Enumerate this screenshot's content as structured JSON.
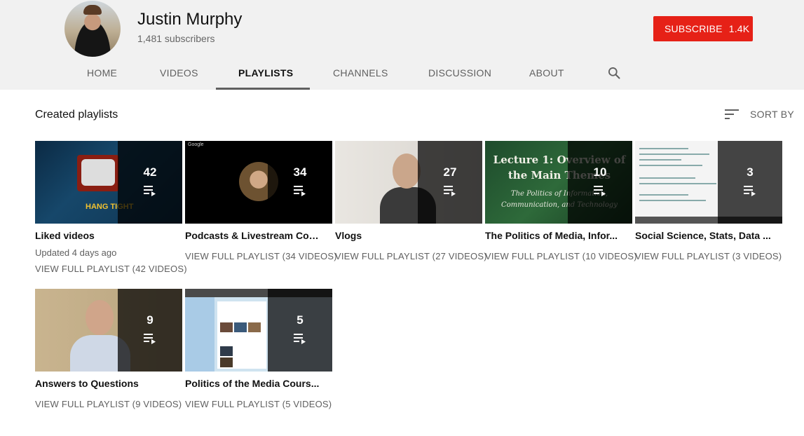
{
  "channel": {
    "name": "Justin Murphy",
    "subscribers": "1,481 subscribers",
    "subscribe_label": "SUBSCRIBE",
    "subscribe_count": "1.4K",
    "accent_color": "#e62117"
  },
  "tabs": [
    {
      "label": "HOME",
      "active": false
    },
    {
      "label": "VIDEOS",
      "active": false
    },
    {
      "label": "PLAYLISTS",
      "active": true
    },
    {
      "label": "CHANNELS",
      "active": false
    },
    {
      "label": "DISCUSSION",
      "active": false
    },
    {
      "label": "ABOUT",
      "active": false
    }
  ],
  "search_icon": "search-icon",
  "section": {
    "title": "Created playlists",
    "sort_label": "SORT BY",
    "sort_icon": "sort-icon"
  },
  "playlists": [
    {
      "title": "Liked videos",
      "count": "42",
      "updated": "Updated 4 days ago",
      "link": "VIEW FULL PLAYLIST (42 VIDEOS)",
      "thumb_text": "HANG TIGHT"
    },
    {
      "title": "Podcasts & Livestream Con...",
      "count": "34",
      "link": "VIEW FULL PLAYLIST (34 VIDEOS)",
      "thumb_text": "Google"
    },
    {
      "title": "Vlogs",
      "count": "27",
      "link": "VIEW FULL PLAYLIST (27 VIDEOS)"
    },
    {
      "title": "The Politics of Media, Infor...",
      "count": "10",
      "link": "VIEW FULL PLAYLIST (10 VIDEOS)",
      "thumb_text": "Lecture 1: Overview of the Main Themes",
      "thumb_subtext": "The Politics of Information, Communication, and Technology"
    },
    {
      "title": "Social Science, Stats, Data ...",
      "count": "3",
      "link": "VIEW FULL PLAYLIST (3 VIDEOS)"
    },
    {
      "title": "Answers to Questions",
      "count": "9",
      "link": "VIEW FULL PLAYLIST (9 VIDEOS)"
    },
    {
      "title": "Politics of the Media Cours...",
      "count": "5",
      "link": "VIEW FULL PLAYLIST (5 VIDEOS)"
    }
  ]
}
